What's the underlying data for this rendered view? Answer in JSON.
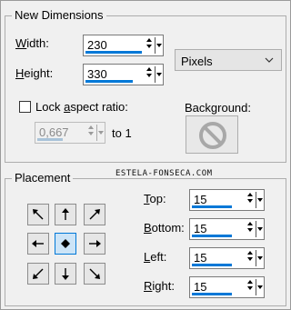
{
  "new_dimensions": {
    "title": "New Dimensions",
    "width": {
      "label_pre": "",
      "label_key": "W",
      "label_post": "idth:",
      "value": "230"
    },
    "height": {
      "label_pre": "",
      "label_key": "H",
      "label_post": "eight:",
      "value": "330"
    },
    "units": {
      "selected": "Pixels"
    },
    "lock_aspect": {
      "label_pre": "Lock ",
      "label_key": "a",
      "label_post": "spect ratio:",
      "checked": false
    },
    "aspect_ratio": {
      "value": "0,667",
      "to_label": "to 1"
    },
    "background": {
      "label": "Background:"
    }
  },
  "watermark": "ESTELA-FONSECA.COM",
  "placement": {
    "title": "Placement",
    "selected": "center",
    "top": {
      "label_key": "T",
      "label_post": "op:",
      "value": "15"
    },
    "bottom": {
      "label_key": "B",
      "label_post": "ottom:",
      "value": "15"
    },
    "left": {
      "label_key": "L",
      "label_post": "eft:",
      "value": "15"
    },
    "right": {
      "label_key": "R",
      "label_post": "ight:",
      "value": "15"
    }
  },
  "colors": {
    "accent": "#0078d7",
    "panel": "#f0f0f0"
  },
  "icons": {
    "grid": [
      "arrow-up-left-icon",
      "arrow-up-icon",
      "arrow-up-right-icon",
      "arrow-left-icon",
      "center-diamond-icon",
      "arrow-right-icon",
      "arrow-down-left-icon",
      "arrow-down-icon",
      "arrow-down-right-icon"
    ],
    "background": "no-color-icon",
    "dropdown": "chevron-down-icon"
  }
}
